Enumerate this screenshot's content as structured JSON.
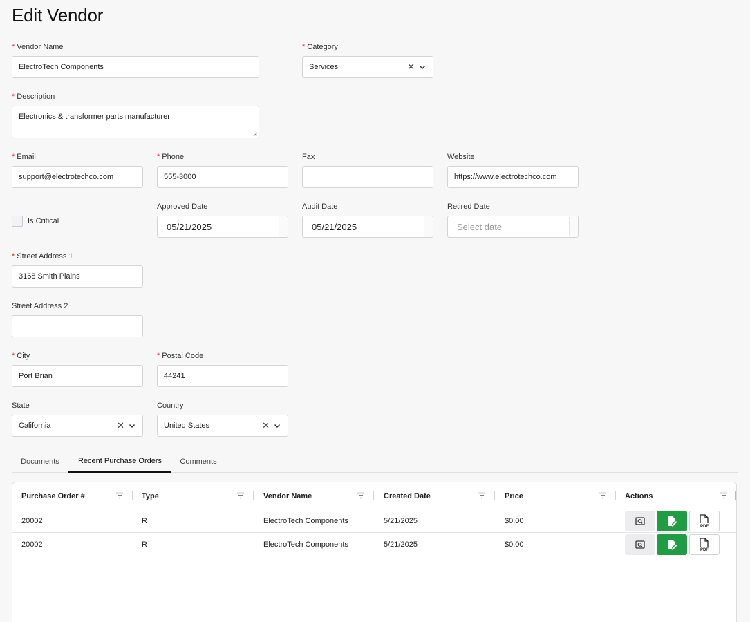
{
  "page": {
    "title": "Edit Vendor"
  },
  "form": {
    "vendor_name": {
      "label": "Vendor Name",
      "value": "ElectroTech Components"
    },
    "category": {
      "label": "Category",
      "value": "Services"
    },
    "description": {
      "label": "Description",
      "value": "Electronics & transformer parts manufacturer"
    },
    "email": {
      "label": "Email",
      "value": "support@electrotechco.com"
    },
    "phone": {
      "label": "Phone",
      "value": "555-3000"
    },
    "fax": {
      "label": "Fax",
      "value": ""
    },
    "website": {
      "label": "Website",
      "value": "https://www.electrotechco.com"
    },
    "is_critical": {
      "label": "Is Critical",
      "checked": false
    },
    "approved_date": {
      "label": "Approved Date",
      "value": "05/21/2025"
    },
    "audit_date": {
      "label": "Audit Date",
      "value": "05/21/2025"
    },
    "retired_date": {
      "label": "Retired Date",
      "value": "",
      "placeholder": "Select date"
    },
    "street1": {
      "label": "Street Address 1",
      "value": "3168 Smith Plains"
    },
    "street2": {
      "label": "Street Address 2",
      "value": ""
    },
    "city": {
      "label": "City",
      "value": "Port Brian"
    },
    "postal_code": {
      "label": "Postal Code",
      "value": "44241"
    },
    "state": {
      "label": "State",
      "value": "California"
    },
    "country": {
      "label": "Country",
      "value": "United States"
    },
    "required_mark": "*",
    "clear_glyph": "✕"
  },
  "tabs": [
    {
      "label": "Documents",
      "active": false
    },
    {
      "label": "Recent Purchase Orders",
      "active": true
    },
    {
      "label": "Comments",
      "active": false
    }
  ],
  "table": {
    "columns": [
      "Purchase Order #",
      "Type",
      "Vendor Name",
      "Created Date",
      "Price",
      "Actions"
    ],
    "rows": [
      {
        "po": "20002",
        "type": "R",
        "vendor": "ElectroTech Components",
        "created": "5/21/2025",
        "price": "$0.00"
      },
      {
        "po": "20002",
        "type": "R",
        "vendor": "ElectroTech Components",
        "created": "5/21/2025",
        "price": "$0.00"
      }
    ],
    "icons": {
      "view": "search-document-icon",
      "edit": "edit-document-icon",
      "pdf": "pdf-file-icon"
    }
  },
  "colors": {
    "required": "#e03131",
    "edit_button": "#1f9d43",
    "tab_active": "#111111"
  }
}
